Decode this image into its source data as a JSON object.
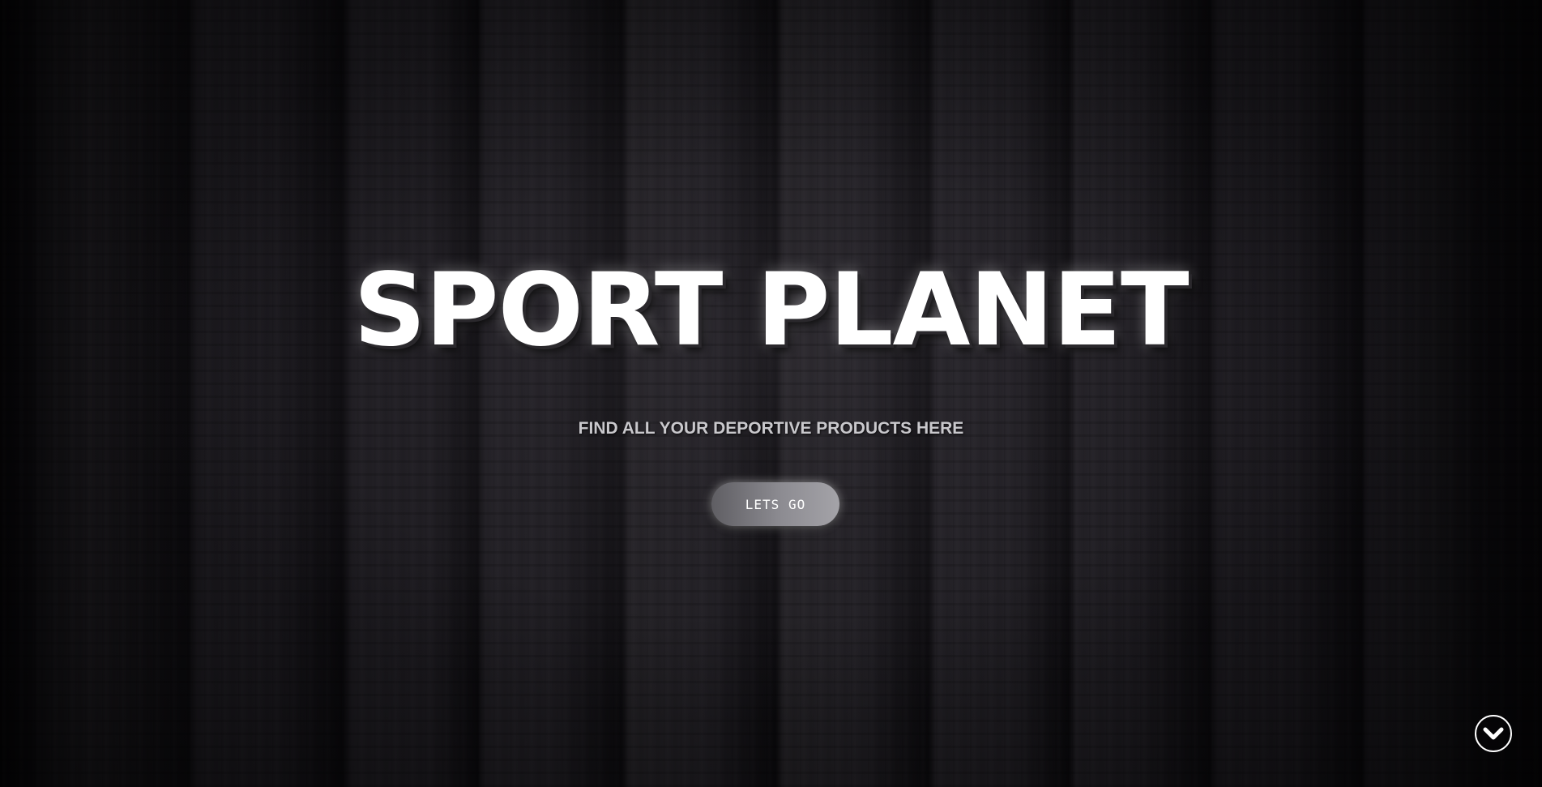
{
  "hero": {
    "title": "SPORT PLANET",
    "subtitle": "FIND ALL YOUR DEPORTIVE PRODUCTS HERE",
    "cta_label": "LETS GO",
    "scroll_icon": "chevron-down-circle-icon"
  },
  "colors": {
    "background": "#1a181c",
    "title": "#ffffff",
    "subtitle": "#c9c8cc",
    "button": "#8d8c92"
  }
}
